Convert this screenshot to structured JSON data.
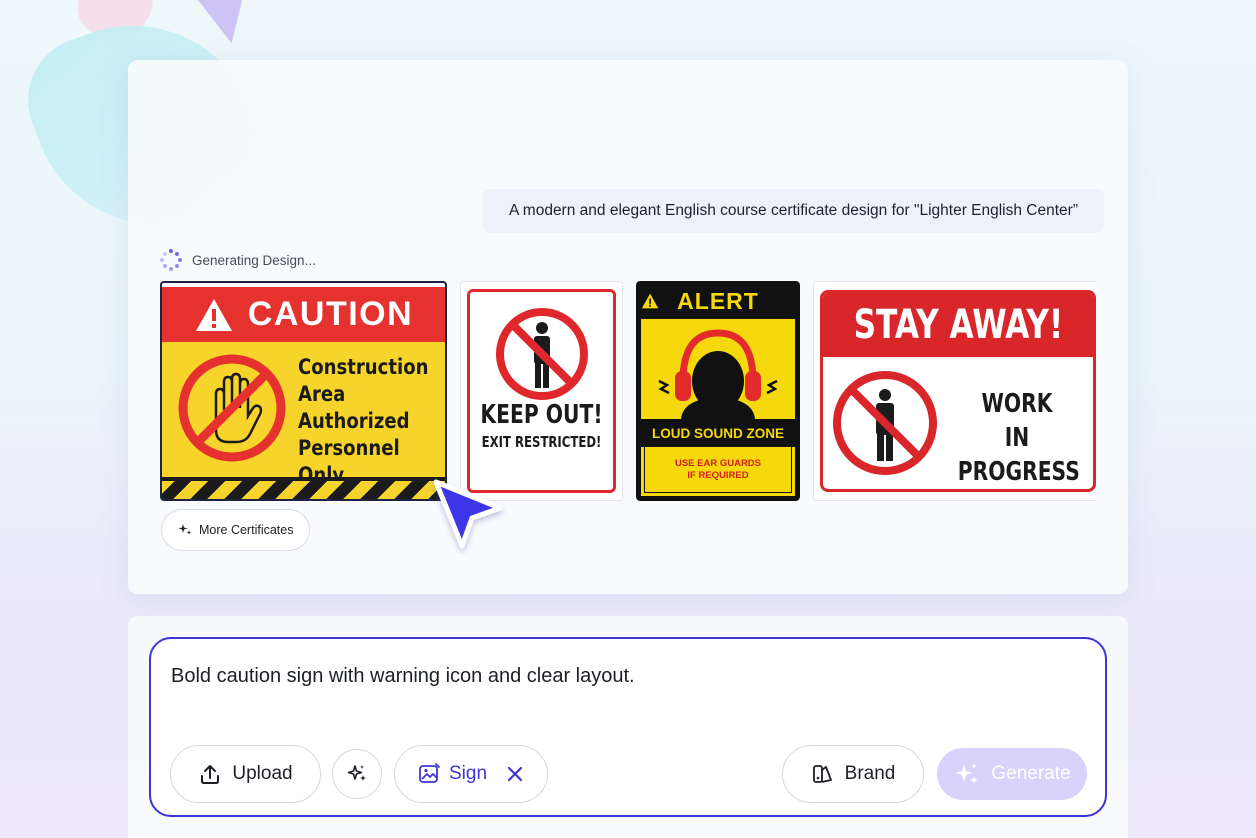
{
  "chat": {
    "user_message": "A modern and elegant English course certificate design for \"Lighter English Center”",
    "status_text": "Generating Design..."
  },
  "cards": {
    "caution": {
      "title": "CAUTION",
      "lines": [
        "Construction",
        "Area",
        "Authorized",
        "Personnel Only"
      ]
    },
    "keep_out": {
      "title": "KEEP OUT!",
      "subtitle": "EXIT RESTRICTED!"
    },
    "alert": {
      "title": "ALERT",
      "band": "LOUD SOUND ZONE",
      "line1": "USE EAR GUARDS",
      "line2": "IF REQUIRED"
    },
    "stay_away": {
      "title": "STAY AWAY!",
      "line1": "WORK",
      "line2": "IN PROGRESS"
    }
  },
  "more_button": "More Certificates",
  "composer": {
    "prompt_text": "Bold caution sign with warning icon and clear layout.",
    "upload_label": "Upload",
    "sign_label": "Sign",
    "brand_label": "Brand",
    "generate_label": "Generate"
  },
  "colors": {
    "accent": "#3d35d6",
    "caution_red": "#e6322f",
    "caution_yellow": "#f6d42b",
    "alert_yellow": "#f5d90c",
    "generate_disabled": "#d8d2fc"
  }
}
